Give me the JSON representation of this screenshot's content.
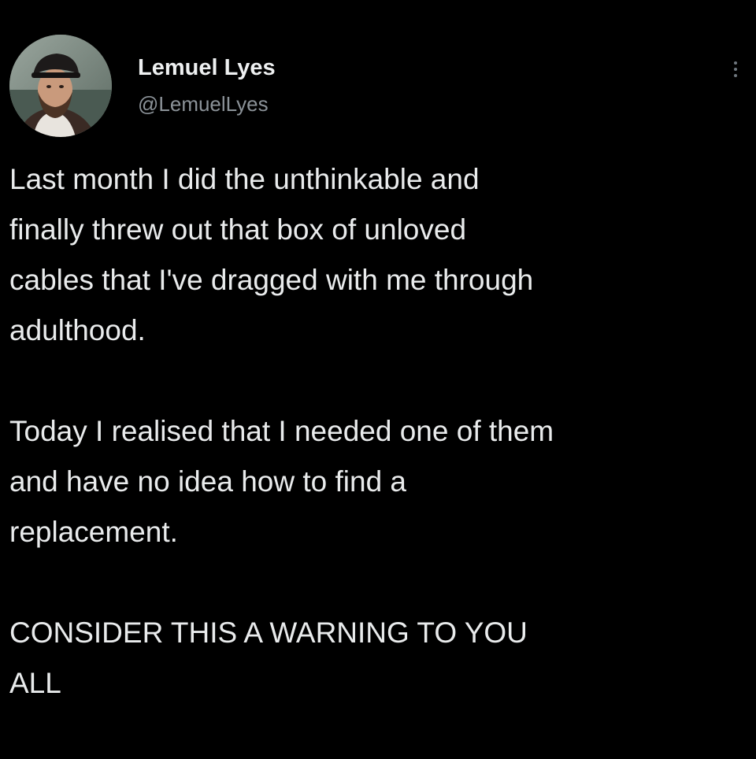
{
  "tweet": {
    "author": {
      "display_name": "Lemuel Lyes",
      "handle": "@LemuelLyes",
      "avatar_icon": "profile-photo"
    },
    "more_icon": "more-options-vertical-icon",
    "paragraphs": [
      {
        "lines": [
          "Last month I did the unthinkable and",
          "finally threw out that box of unloved",
          "cables that I've dragged with me through",
          "adulthood."
        ]
      },
      {
        "lines": [
          "Today I realised that I needed one of them",
          "and have no idea how to find a",
          "replacement."
        ]
      },
      {
        "lines": [
          "CONSIDER THIS A WARNING TO YOU",
          "ALL"
        ]
      }
    ]
  },
  "colors": {
    "background": "#000000",
    "text_primary": "#e7e9ea",
    "text_secondary": "#8b9298"
  }
}
